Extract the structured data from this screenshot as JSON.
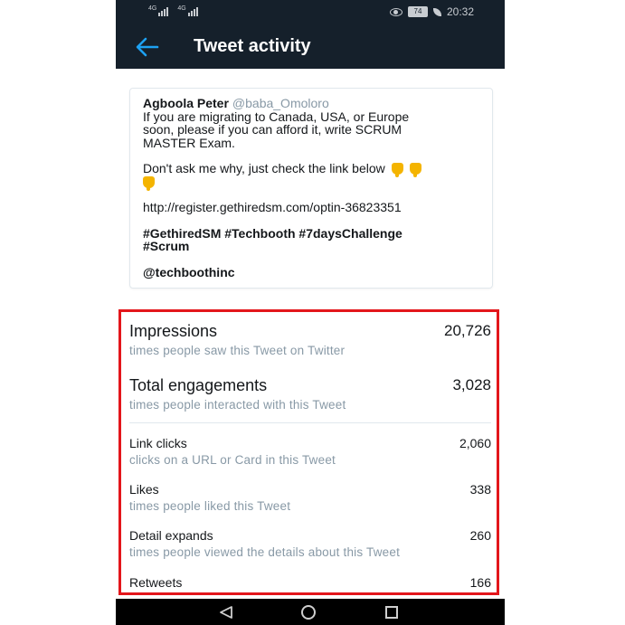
{
  "status_bar": {
    "signal_label_1": "4G",
    "signal_label_2": "4G",
    "battery": "74",
    "time": "20:32"
  },
  "app_bar": {
    "title": "Tweet activity"
  },
  "tweet": {
    "author_name": "Agboola Peter",
    "author_handle": "@baba_Omoloro",
    "line1": "If you are migrating to Canada, USA, or Europe",
    "line2": "soon, please if you can afford it, write SCRUM",
    "line3": "MASTER Exam.",
    "line4": "Don't ask me why, just check the link below",
    "link": "http://register.gethiredsm.com/optin-36823351",
    "hashtags_line1": "#GethiredSM #Techbooth #7daysChallenge",
    "hashtags_line2": "#Scrum",
    "mention": "@techboothinc"
  },
  "metrics": {
    "impressions": {
      "label": "Impressions",
      "value": "20,726",
      "desc": "times people saw this Tweet on Twitter"
    },
    "engagements": {
      "label": "Total engagements",
      "value": "3,028",
      "desc": "times people interacted with this Tweet"
    },
    "link_clicks": {
      "label": "Link clicks",
      "value": "2,060",
      "desc": "clicks on a URL or Card in this Tweet"
    },
    "likes": {
      "label": "Likes",
      "value": "338",
      "desc": "times people liked this Tweet"
    },
    "detail_expands": {
      "label": "Detail expands",
      "value": "260",
      "desc": "times people viewed the details about this Tweet"
    },
    "retweets": {
      "label": "Retweets",
      "value": "166"
    }
  },
  "colors": {
    "app_bar_bg": "#15202b",
    "highlight_box": "#e3161b",
    "back_arrow": "#1da1f2",
    "secondary_text": "#8899a6"
  }
}
